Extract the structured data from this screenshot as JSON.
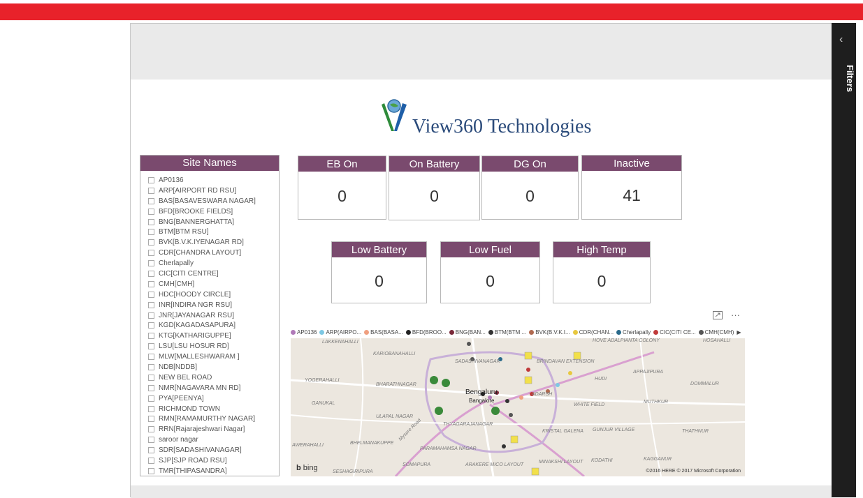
{
  "filters": {
    "label": "Filters",
    "chevron": "‹"
  },
  "logo": {
    "text": "View360 Technologies",
    "icon": "globe-hands-logo"
  },
  "site_panel": {
    "title": "Site Names",
    "items": [
      "AP0136",
      "ARP[AIRPORT RD RSU]",
      "BAS[BASAVESWARA NAGAR]",
      "BFD[BROOKE FIELDS]",
      "BNG[BANNERGHATTA]",
      "BTM[BTM RSU]",
      "BVK[B.V.K.IYENAGAR RD]",
      "CDR[CHANDRA LAYOUT]",
      "Cherlapally",
      "CIC[CITI CENTRE]",
      "CMH[CMH]",
      "HDC[HOODY CIRCLE]",
      "INR[INDIRA NGR RSU]",
      "JNR[JAYANAGAR RSU]",
      "KGD[KAGADASAPURA]",
      "KTG[KATHARIGUPPE]",
      "LSU[LSU HOSUR RD]",
      "MLW[MALLESHWARAM ]",
      "NDB[NDDB]",
      "NEW BEL ROAD",
      "NMR[NAGAVARA MN RD]",
      "PYA[PEENYA]",
      "RICHMOND TOWN",
      "RMN[RAMAMURTHY NAGAR]",
      "RRN[Rajarajeshwari Nagar]",
      "saroor nagar",
      "SDR[SADASHIVANAGAR]",
      "SJP[SJP ROAD RSU]",
      "TMR[THIPASANDRA]"
    ]
  },
  "cards": {
    "eb_on": {
      "title": "EB On",
      "value": "0"
    },
    "on_battery": {
      "title": "On Battery",
      "value": "0"
    },
    "dg_on": {
      "title": "DG On",
      "value": "0"
    },
    "inactive": {
      "title": "Inactive",
      "value": "41"
    },
    "low_battery": {
      "title": "Low Battery",
      "value": "0"
    },
    "low_fuel": {
      "title": "Low Fuel",
      "value": "0"
    },
    "high_temp": {
      "title": "High Temp",
      "value": "0"
    }
  },
  "map": {
    "toolbar_focus_icon": "focus-mode-icon",
    "toolbar_more": "···",
    "legend": [
      {
        "label": "AP0136",
        "color": "#b07ab8"
      },
      {
        "label": "ARP(AIRPO...",
        "color": "#7ec8e3"
      },
      {
        "label": "BAS(BASA...",
        "color": "#f0a080"
      },
      {
        "label": "BFD(BROO...",
        "color": "#222222"
      },
      {
        "label": "BNG(BAN...",
        "color": "#7a2a3a"
      },
      {
        "label": "BTM(BTM ...",
        "color": "#333333"
      },
      {
        "label": "BVK(B.V.K.I...",
        "color": "#b06a50"
      },
      {
        "label": "CDR(CHAN...",
        "color": "#e8c840"
      },
      {
        "label": "Cherlapally",
        "color": "#2a6a8a"
      },
      {
        "label": "CIC(CITI CE...",
        "color": "#c03a3a"
      },
      {
        "label": "CMH(CMH)",
        "color": "#555555"
      }
    ],
    "legend_more": "▶",
    "city": "Bengaluru",
    "city_local": "Bangalore",
    "place_labels": [
      "LAKKENAHALLI",
      "KARIOBANAHALLI",
      "SADASHIVANAGAR",
      "BRINDAVAN EXTENSION",
      "HOVE ADALPIANTA COLONY",
      "HOSAHALLI",
      "YOGERAHALLI",
      "BHARATHNAGAR",
      "APPAJIPURA",
      "DOMMALUR",
      "GANUKAL",
      "WHITE FIELD",
      "MUTHKUR",
      "ULAPAL NAGAR",
      "THYAGARAJANAGAR",
      "KRISTAL GALENA",
      "GUNJUR VILLAGE",
      "THATHNUR",
      "AWERAHALLI",
      "BHELMANAKUPPE",
      "PARAMAHAMSA NAGAR",
      "SOMAPURA",
      "ARAKERE MICO LAYOUT",
      "MINAKSHI LAYOUT",
      "KODATHI",
      "KAGGANUR",
      "SESHAGIRIPURA",
      "Mysore Road",
      "HUDI",
      "ADARSH"
    ],
    "bing": "bing",
    "copyright": "©2016 HERE   © 2017 Microsoft Corporation"
  }
}
